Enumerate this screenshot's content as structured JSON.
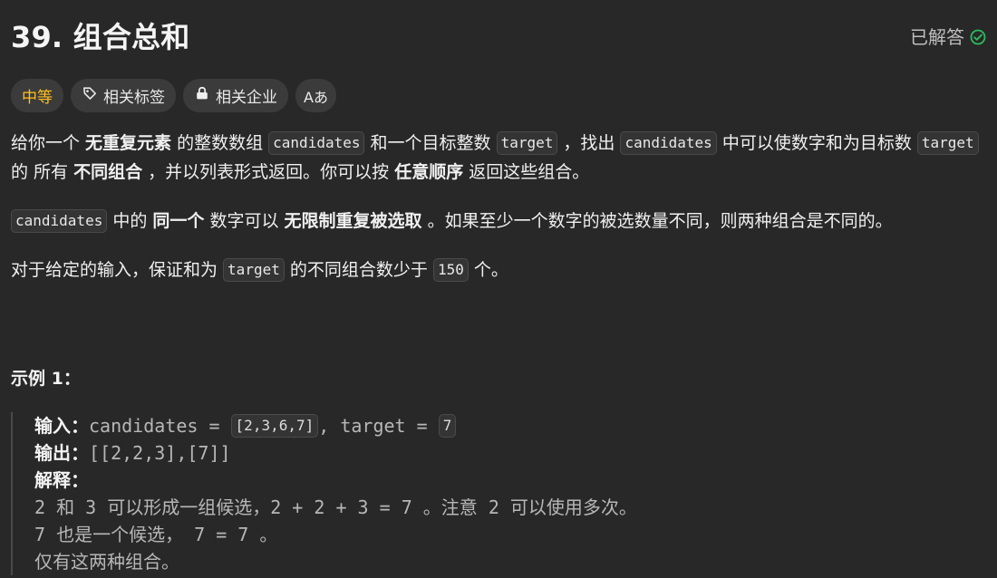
{
  "header": {
    "title": "39. 组合总和",
    "status_label": "已解答",
    "status_color": "#2cbb5d"
  },
  "tags": [
    {
      "label": "中等",
      "icon": ""
    },
    {
      "label": "相关标签",
      "icon": "tag-icon"
    },
    {
      "label": "相关企业",
      "icon": "lock-icon"
    },
    {
      "label": "Aあ",
      "icon": "translate-icon"
    }
  ],
  "description": {
    "p1": {
      "t1": "给你一个 ",
      "b1": "无重复元素",
      "t2": " 的整数数组 ",
      "c1": "candidates",
      "t3": " 和一个目标整数 ",
      "c2": "target",
      "t4": " ，找出 ",
      "c3": "candidates",
      "t5": " 中可以使数字和为目标数 ",
      "c4": "target",
      "t6": " 的 所有 ",
      "b2": "不同组合",
      "t7": " ，并以列表形式返回。你可以按 ",
      "b3": "任意顺序",
      "t8": " 返回这些组合。"
    },
    "p2": {
      "c1": "candidates",
      "t1": " 中的 ",
      "b1": "同一个",
      "t2": " 数字可以 ",
      "b2": "无限制重复被选取",
      "t3": " 。如果至少一个数字的被选数量不同，则两种组合是不同的。"
    },
    "p3": {
      "t1": "对于给定的输入，保证和为 ",
      "c1": "target",
      "t2": " 的不同组合数少于 ",
      "c2": "150",
      "t3": " 个。"
    }
  },
  "example": {
    "title": "示例 1：",
    "input_label": "输入：",
    "input_prefix": "candidates = ",
    "input_array": "[2,3,6,7]",
    "input_mid": ", target = ",
    "input_target": "7",
    "output_label": "输出：",
    "output_value": "[[2,2,3],[7]]",
    "explain_label": "解释：",
    "lines": [
      "2 和 3 可以形成一组候选，2 + 2 + 3 = 7 。注意 2 可以使用多次。",
      "7 也是一个候选， 7 = 7 。",
      "仅有这两种组合。"
    ]
  }
}
